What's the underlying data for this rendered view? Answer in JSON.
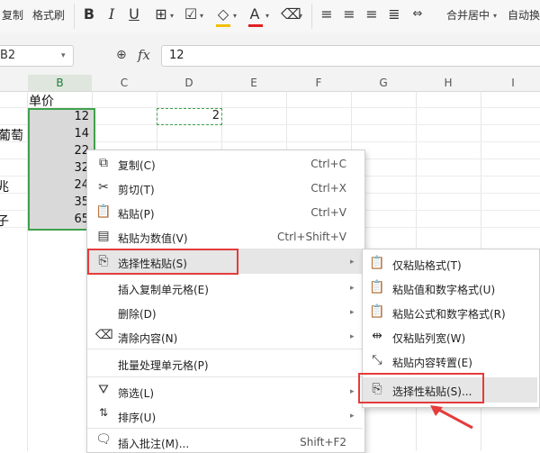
{
  "ribbon": {
    "copy_label": "复制",
    "format_painter_label": "格式刷",
    "merge_label": "合并居中",
    "merge_caret": "▾",
    "autowrap_label": "自动换",
    "bold": "B",
    "italic": "I",
    "underline": "U",
    "font_color_glyph": "A",
    "font_color": "#e02020"
  },
  "formula_bar": {
    "name_box": "B2",
    "name_caret": "▾",
    "zoom_icon": "🔍",
    "fx_label": "fx",
    "formula_value": "12"
  },
  "columns": [
    "B",
    "C",
    "D",
    "E",
    "F",
    "G",
    "H",
    "I"
  ],
  "column_a_fragments": [
    "葡萄",
    "兆",
    "子"
  ],
  "cells": {
    "b_header": "单价",
    "b_values": [
      "12",
      "14",
      "22",
      "32",
      "24",
      "35",
      "65"
    ],
    "d_copied": "2"
  },
  "context_menu": {
    "items": [
      {
        "icon": "copy-icon",
        "label": "复制(C)",
        "shortcut": "Ctrl+C"
      },
      {
        "icon": "scissors-icon",
        "label": "剪切(T)",
        "shortcut": "Ctrl+X"
      },
      {
        "icon": "paste-icon",
        "label": "粘贴(P)",
        "shortcut": "Ctrl+V"
      },
      {
        "icon": "paste-values-icon",
        "label": "粘贴为数值(V)",
        "shortcut": "Ctrl+Shift+V"
      },
      {
        "icon": "paste-special-icon",
        "label": "选择性粘贴(S)",
        "shortcut": ""
      },
      {
        "icon": "",
        "label": "插入复制单元格(E)",
        "shortcut": ""
      },
      {
        "icon": "",
        "label": "删除(D)",
        "shortcut": ""
      },
      {
        "icon": "eraser-icon",
        "label": "清除内容(N)",
        "shortcut": ""
      },
      {
        "icon": "",
        "label": "批量处理单元格(P)",
        "shortcut": ""
      },
      {
        "icon": "filter-icon",
        "label": "筛选(L)",
        "shortcut": ""
      },
      {
        "icon": "sort-icon",
        "label": "排序(U)",
        "shortcut": ""
      },
      {
        "icon": "comment-icon",
        "label": "插入批注(M)...",
        "shortcut": "Shift+F2"
      }
    ],
    "arrow": "▸"
  },
  "submenu": {
    "items": [
      {
        "label": "仅粘贴格式(T)"
      },
      {
        "label": "粘贴值和数字格式(U)"
      },
      {
        "label": "粘贴公式和数字格式(R)"
      },
      {
        "label": "仅粘贴列宽(W)"
      },
      {
        "label": "粘贴内容转置(E)"
      },
      {
        "label": "选择性粘贴(S)..."
      }
    ]
  },
  "colors": {
    "selection_border": "#3fa14d",
    "highlight_box": "#e53b3b"
  }
}
